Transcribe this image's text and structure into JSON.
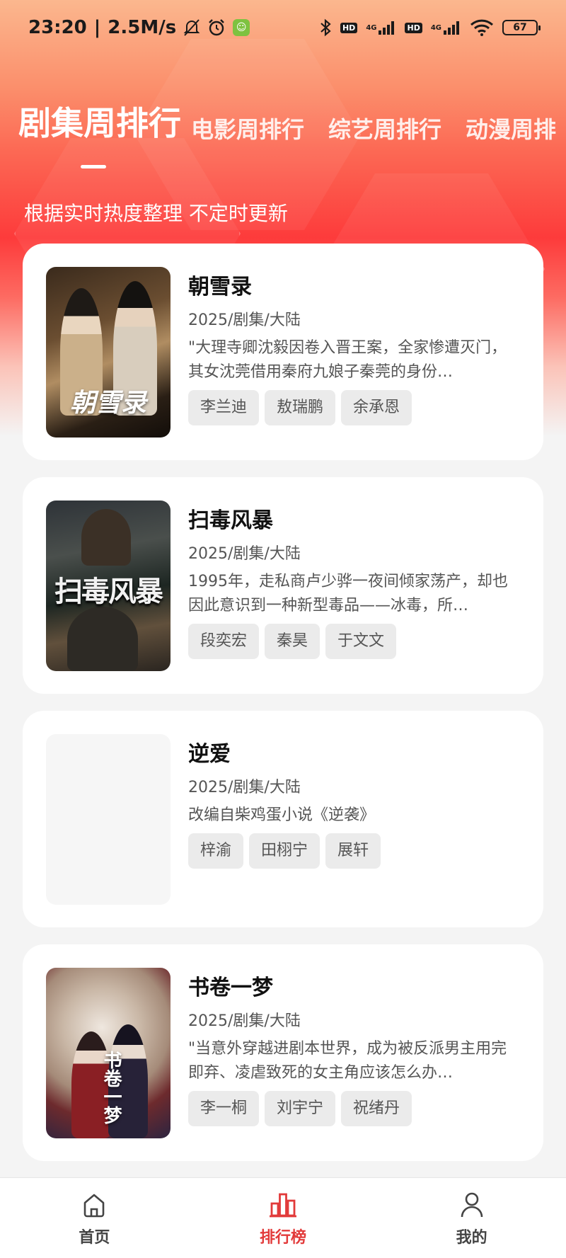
{
  "status_bar": {
    "time": "23:20",
    "speed": "2.5M/s",
    "battery": "67",
    "network_4g_1": "4G",
    "network_4g_2": "4G",
    "hd_1": "HD",
    "hd_2": "HD"
  },
  "tabs": [
    {
      "label": "剧集周排行",
      "active": true
    },
    {
      "label": "电影周排行",
      "active": false
    },
    {
      "label": "综艺周排行",
      "active": false
    },
    {
      "label": "动漫周排"
    }
  ],
  "subtitle": "根据实时热度整理 不定时更新",
  "items": [
    {
      "title": "朝雪录",
      "meta": "2025/剧集/大陆",
      "desc": "\"大理寺卿沈毅因卷入晋王案，全家惨遭灭门，其女沈莞借用秦府九娘子秦莞的身份…",
      "poster_text": "朝雪录",
      "tags": [
        "李兰迪",
        "敖瑞鹏",
        "余承恩"
      ]
    },
    {
      "title": "扫毒风暴",
      "meta": "2025/剧集/大陆",
      "desc": "1995年，走私商卢少骅一夜间倾家荡产，却也因此意识到一种新型毒品——冰毒，所…",
      "poster_text": "扫毒风暴",
      "tags": [
        "段奕宏",
        "秦昊",
        "于文文"
      ]
    },
    {
      "title": "逆爱",
      "meta": "2025/剧集/大陆",
      "desc": "改编自柴鸡蛋小说《逆袭》",
      "poster_text": "",
      "tags": [
        "梓渝",
        "田栩宁",
        "展轩"
      ]
    },
    {
      "title": "书卷一梦",
      "meta": "2025/剧集/大陆",
      "desc": "\"当意外穿越进剧本世界，成为被反派男主用完即弃、凌虐致死的女主角应该怎么办…",
      "poster_text": "书卷一梦",
      "tags": [
        "李一桐",
        "刘宇宁",
        "祝绪丹"
      ]
    }
  ],
  "bottom_nav": [
    {
      "label": "首页",
      "icon": "home-icon"
    },
    {
      "label": "排行榜",
      "icon": "chart-icon",
      "active": true
    },
    {
      "label": "我的",
      "icon": "user-icon"
    }
  ],
  "colors": {
    "accent": "#e23a3a",
    "hero_top": "#fbb78e",
    "hero_mid": "#fd3b3b"
  }
}
